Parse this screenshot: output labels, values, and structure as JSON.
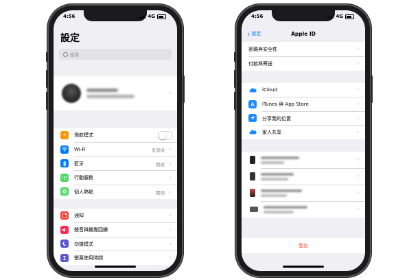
{
  "left_phone": {
    "status": {
      "time": "4:56",
      "network": "4G"
    },
    "title": "設定",
    "search_placeholder": "搜尋",
    "group1": [
      {
        "icon": "airplane-icon",
        "color": "#ff9500",
        "label": "飛航模式",
        "toggle": "off"
      },
      {
        "icon": "wifi-icon",
        "color": "#007aff",
        "label": "Wi-Fi",
        "value": "未連接"
      },
      {
        "icon": "bluetooth-icon",
        "color": "#007aff",
        "label": "藍牙",
        "value": "開啟"
      },
      {
        "icon": "cellular-icon",
        "color": "#4cd964",
        "label": "行動服務"
      },
      {
        "icon": "hotspot-icon",
        "color": "#4cd964",
        "label": "個人熱點",
        "value": "關閉"
      }
    ],
    "group2": [
      {
        "icon": "notifications-icon",
        "color": "#ff3b30",
        "label": "通知"
      },
      {
        "icon": "sounds-icon",
        "color": "#ff2d55",
        "label": "聲音與觸覺回饋"
      },
      {
        "icon": "do-not-disturb-icon",
        "color": "#5856d6",
        "label": "勿擾模式"
      },
      {
        "icon": "screen-time-icon",
        "color": "#5856d6",
        "label": "螢幕使用時間"
      }
    ]
  },
  "right_phone": {
    "status": {
      "time": "4:56",
      "network": "4G"
    },
    "nav_back": "設定",
    "nav_title": "Apple ID",
    "group1": [
      "密碼與安全性",
      "付款與寄送"
    ],
    "group2": [
      {
        "icon": "icloud-icon",
        "color": "#1a8cff",
        "label": "iCloud"
      },
      {
        "icon": "app-store-icon",
        "color": "#1a8cff",
        "label": "iTunes 與 App Store"
      },
      {
        "icon": "find-my-icon",
        "color": "#1a8cff",
        "label": "分享我的位置"
      },
      {
        "icon": "family-icon",
        "color": "#1a8cff",
        "label": "家人共享"
      }
    ],
    "sign_out": "登出"
  }
}
